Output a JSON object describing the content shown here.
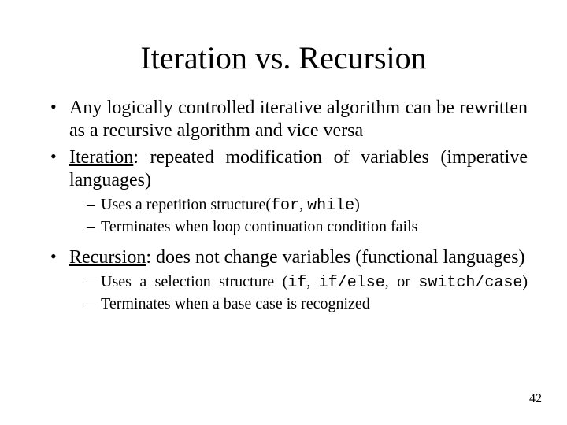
{
  "title": "Iteration vs. Recursion",
  "bullets": {
    "b1": "Any logically controlled iterative algorithm can be rewritten as a recursive algorithm and vice versa",
    "b2_lead": "Iteration",
    "b2_rest": ": repeated modification of variables (imperative languages)",
    "b2_sub1_a": "Uses a repetition structure(",
    "b2_sub1_for": "for",
    "b2_sub1_sep": ", ",
    "b2_sub1_while": "while",
    "b2_sub1_close": ")",
    "b2_sub2": "Terminates when loop continuation condition fails",
    "b3_lead": "Recursion",
    "b3_rest": ": does not change variables (functional languages)",
    "b3_sub1_a": "Uses a selection structure (",
    "b3_sub1_if": "if",
    "b3_sub1_sep1": ", ",
    "b3_sub1_ifelse": "if/else",
    "b3_sub1_sep2": ", or ",
    "b3_sub1_switch": "switch/case",
    "b3_sub1_close": ")",
    "b3_sub2": "Terminates when a base case is recognized"
  },
  "page_number": "42"
}
